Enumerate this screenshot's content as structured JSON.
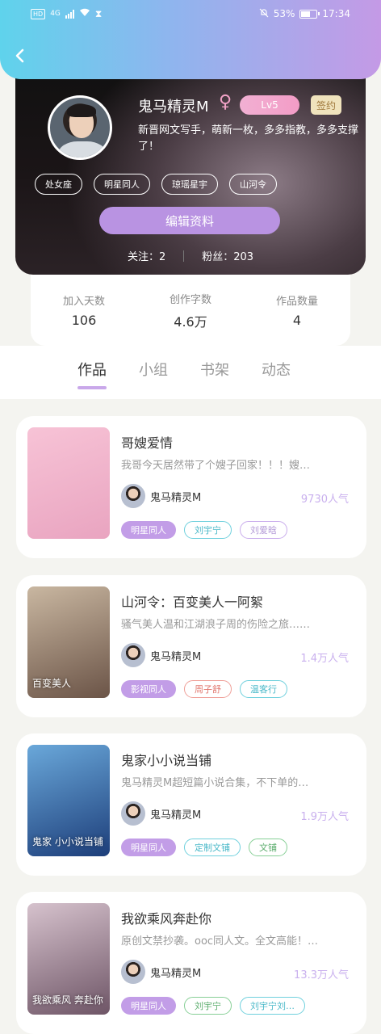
{
  "status_bar": {
    "signal_label": "4G",
    "battery_percent": "53%",
    "time": "17:34"
  },
  "profile": {
    "nickname": "鬼马精灵M",
    "level": "Lv5",
    "sign_badge": "签约",
    "bio": "新晋网文写手，萌新一枚，多多指教，多多支撑了！",
    "tags": [
      "处女座",
      "明星同人",
      "琼瑶星宇",
      "山河令"
    ],
    "edit_button": "编辑资料",
    "follow_label": "关注：2",
    "fans_label": "粉丝：203"
  },
  "stats": [
    {
      "label": "加入天数",
      "value": "106"
    },
    {
      "label": "创作字数",
      "value": "4.6万"
    },
    {
      "label": "作品数量",
      "value": "4"
    }
  ],
  "tabs": [
    {
      "label": "作品",
      "active": true
    },
    {
      "label": "小组",
      "active": false
    },
    {
      "label": "书架",
      "active": false
    },
    {
      "label": "动态",
      "active": false
    }
  ],
  "works": [
    {
      "title": "哥嫂爱情",
      "desc": "我哥今天居然带了个嫂子回家！！！嫂…",
      "author": "鬼马精灵M",
      "count": "9730人气",
      "cover_colors": [
        "#f7c3d6",
        "#e9a4c0"
      ],
      "tags": [
        {
          "label": "明星同人",
          "style": "purple"
        },
        {
          "label": "刘宇宁",
          "style": "cyan"
        },
        {
          "label": "刘爱晗",
          "style": "lav"
        }
      ]
    },
    {
      "title": "山河令：百变美人一阿絮",
      "desc": "骚气美人温和江湖浪子周的伤险之旅……",
      "author": "鬼马精灵M",
      "count": "1.4万人气",
      "cover_colors": [
        "#c9b7a1",
        "#6b5447"
      ],
      "cover_text": "百变美人",
      "tags": [
        {
          "label": "影视同人",
          "style": "purple"
        },
        {
          "label": "周子舒",
          "style": "red"
        },
        {
          "label": "温客行",
          "style": "cyan"
        }
      ]
    },
    {
      "title": "鬼家小小说当铺",
      "desc": "鬼马精灵M超短篇小说合集，不下单的…",
      "author": "鬼马精灵M",
      "count": "1.9万人气",
      "cover_colors": [
        "#6aa8da",
        "#1d3e7a"
      ],
      "cover_text": "鬼家 小小说当铺",
      "tags": [
        {
          "label": "明星同人",
          "style": "purple"
        },
        {
          "label": "定制文铺",
          "style": "cyan"
        },
        {
          "label": "文铺",
          "style": "green"
        }
      ]
    },
    {
      "title": "我欲乘风奔赴你",
      "desc": "原创文禁抄袭。ooc同人文。全文高能！…",
      "author": "鬼马精灵M",
      "count": "13.3万人气",
      "cover_colors": [
        "#d6c2cd",
        "#6e5566"
      ],
      "cover_text": "我欲乘风 奔赴你",
      "tags": [
        {
          "label": "明星同人",
          "style": "purple"
        },
        {
          "label": "刘宇宁",
          "style": "green"
        },
        {
          "label": "刘宇宁刘…",
          "style": "cyan"
        }
      ]
    }
  ]
}
